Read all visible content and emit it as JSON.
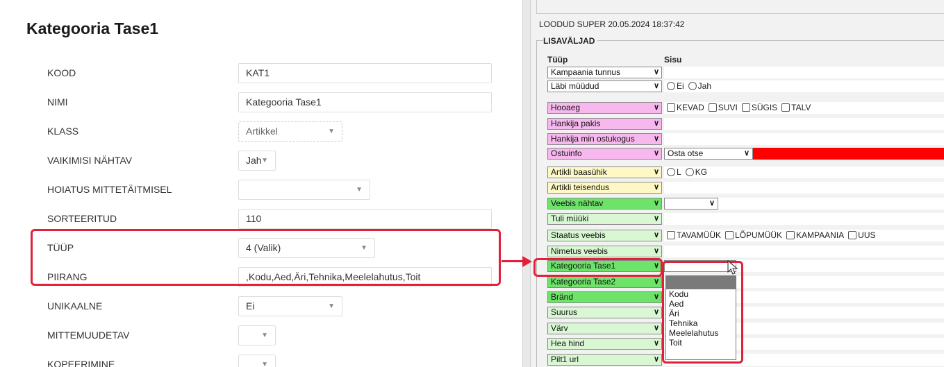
{
  "left": {
    "title": "Kategooria Tase1",
    "fields": [
      {
        "label": "KOOD",
        "value": "KAT1",
        "kind": "input"
      },
      {
        "label": "NIMI",
        "value": "Kategooria Tase1",
        "kind": "input"
      },
      {
        "label": "KLASS",
        "value": "Artikkel",
        "kind": "select-disabled"
      },
      {
        "label": "VAIKIMISI NÄHTAV",
        "value": "Jah",
        "kind": "select"
      },
      {
        "label": "HOIATUS MITTETÄITMISEL",
        "value": "",
        "kind": "select"
      },
      {
        "label": "SORTEERITUD",
        "value": "110",
        "kind": "input"
      },
      {
        "label": "TÜÜP",
        "value": "4 (Valik)",
        "kind": "select"
      },
      {
        "label": "PIIRANG",
        "value": ",Kodu,Aed,Äri,Tehnika,Meelelahutus,Toit",
        "kind": "input"
      },
      {
        "label": "UNIKAALNE",
        "value": "Ei",
        "kind": "select"
      },
      {
        "label": "MITTEMUUDETAV",
        "value": "",
        "kind": "select"
      },
      {
        "label": "KOPEERIMINE",
        "value": "",
        "kind": "select"
      }
    ]
  },
  "right": {
    "created": "LOODUD SUPER 20.05.2024 18:37:42",
    "section": "LISAVÄLJAD",
    "col_type": "Tüüp",
    "col_content": "Sisu",
    "rows": [
      {
        "type": "Kampaania tunnus",
        "color": "#ffffff"
      },
      {
        "type": "Läbi müüdud",
        "color": "#ffffff",
        "radios": [
          "Ei",
          "Jah"
        ]
      },
      {
        "type": "Hooaeg",
        "color": "#f7b8ee",
        "checks": [
          "KEVAD",
          "SUVI",
          "SÜGIS",
          "TALV"
        ]
      },
      {
        "type": "Hankija pakis",
        "color": "#f7b8ee"
      },
      {
        "type": "Hankija min ostukogus",
        "color": "#f7b8ee"
      },
      {
        "type": "Ostuinfo",
        "color": "#f7b8ee",
        "select": "Osta otse",
        "highlight": "#ff0000"
      },
      {
        "type": "Artikli baasühik",
        "color": "#fdf8c4",
        "radios": [
          "L",
          "KG"
        ]
      },
      {
        "type": "Artikli teisendus",
        "color": "#fdf8c4"
      },
      {
        "type": "Veebis nähtav",
        "color": "#6ee36a",
        "select": ""
      },
      {
        "type": "Tuli müüki",
        "color": "#d9f7d2"
      },
      {
        "type": "Staatus veebis",
        "color": "#d9f7d2",
        "checks": [
          "TAVAMÜÜK",
          "LÕPUMÜÜK",
          "KAMPAANIA",
          "UUS"
        ]
      },
      {
        "type": "Nimetus veebis",
        "color": "#d9f7d2"
      },
      {
        "type": "Kategooria Tase1",
        "color": "#6ee36a",
        "select": ""
      },
      {
        "type": "Kategooria Tase2",
        "color": "#6ee36a"
      },
      {
        "type": "Bränd",
        "color": "#6ee36a"
      },
      {
        "type": "Suurus",
        "color": "#d9f7d2"
      },
      {
        "type": "Värv",
        "color": "#d9f7d2"
      },
      {
        "type": "Hea hind",
        "color": "#d9f7d2"
      },
      {
        "type": "Pilt1 url",
        "color": "#d9f7d2"
      }
    ],
    "dropdown_options": [
      "",
      "Kodu",
      "Aed",
      "Äri",
      "Tehnika",
      "Meelelahutus",
      "Toit"
    ]
  },
  "colors": {
    "highlight": "#e2203a"
  }
}
